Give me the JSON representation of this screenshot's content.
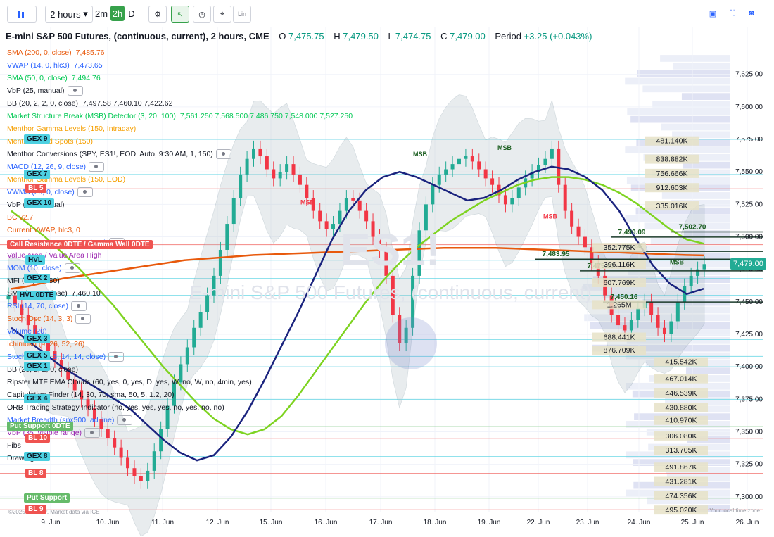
{
  "toolbar": {
    "interval_label": "2 hours",
    "quick_intervals": [
      "2m",
      "2h",
      "D"
    ],
    "active_interval": "2h",
    "lin_label": "Lin"
  },
  "header": {
    "symbol": "E-mini S&P 500 Futures, (continuous, current), 2 hours, CME",
    "open_label": "O",
    "open": "7,475.75",
    "high_label": "H",
    "high": "7,479.50",
    "low_label": "L",
    "low": "7,474.75",
    "close_label": "C",
    "close": "7,479.00",
    "period_label": "Period",
    "period": "+3.25 (+0.043%)"
  },
  "indicators": [
    {
      "text": "SMA (200, 0, close)",
      "value": "7,485.76",
      "color": "#e8590c"
    },
    {
      "text": "VWAP (14, 0, hlc3)",
      "value": "7,473.65",
      "color": "#2962ff"
    },
    {
      "text": "SMA (50, 0, close)",
      "value": "7,494.76",
      "color": "#00c853"
    },
    {
      "text": "VbP (25, manual)",
      "value": "",
      "color": "#131722"
    },
    {
      "text": "BB (20, 2, 2, 0, close)",
      "value": "7,497.58  7,460.10  7,422.62",
      "color": "#131722"
    },
    {
      "text": "Market Structure Break (MSB) Detector (3, 20, 100)",
      "value": "7,561.250  7,568.500  7,486.750  7,548.000  7,527.250",
      "color": "#00c853"
    },
    {
      "text": "Menthor Gamma Levels (150, Intraday)",
      "value": "",
      "color": "#f59f00"
    },
    {
      "text": "Menthor Blind Spots (150)",
      "value": "",
      "color": "#f59f00"
    },
    {
      "text": "Menthor Conversions (SPY, ES1!, EOD, Auto, 9:30 AM, 1, 150)",
      "value": "",
      "color": "#131722"
    },
    {
      "text": "MACD (12, 26, 9, close)",
      "value": "",
      "color": "#2962ff"
    },
    {
      "text": "Menthor Gamma Levels (150, EOD)",
      "value": "",
      "color": "#f59f00"
    },
    {
      "text": "VWMA (20, 0, close)",
      "value": "",
      "color": "#2962ff"
    },
    {
      "text": "VbP (35, manual)",
      "value": "",
      "color": "#131722"
    },
    {
      "text": "BC v2.7",
      "value": "",
      "color": "#e8590c"
    },
    {
      "text": "Current VWAP, hlc3, 0",
      "value": "",
      "color": "#e8590c"
    },
    {
      "text": "URSI (14, 20, 2, 80, 20, close)",
      "value": "",
      "color": "#2962ff"
    },
    {
      "text": "Value Area / Value Area High",
      "value": "",
      "color": "#9c27b0"
    },
    {
      "text": "MOM (10, close)",
      "value": "",
      "color": "#2962ff"
    },
    {
      "text": "MFI (14, 20, 80)",
      "value": "",
      "color": "#131722"
    },
    {
      "text": "SMA (20, 0, close)",
      "value": "7,460.10",
      "color": "#131722"
    },
    {
      "text": "RSI (14, 70, close)",
      "value": "",
      "color": "#2962ff"
    },
    {
      "text": "Stoch Osc (14, 3, 3)",
      "value": "",
      "color": "#e8590c"
    },
    {
      "text": "Volume (20)",
      "value": "",
      "color": "#2962ff"
    },
    {
      "text": "Ichimoku (9, 26, 52, 26)",
      "value": "",
      "color": "#e8590c"
    },
    {
      "text": "Stoch RSI (3, 3, 14, 14, close)",
      "value": "",
      "color": "#2962ff"
    },
    {
      "text": "BB (20, 2, 2, 0, close)",
      "value": "",
      "color": "#131722"
    },
    {
      "text": "Ripster MTF EMA Clouds (60, yes, 0, yes, D, yes, W, no, W, no, 4min, yes)",
      "value": "",
      "color": "#131722"
    },
    {
      "text": "Capitulation Finder (14, 30, 70, sma, 50, 5, 1.2, 20)",
      "value": "",
      "color": "#131722"
    },
    {
      "text": "ORB Trading Strategy Indicator (no, yes, yes, yes, no, yes, no, no)",
      "value": "",
      "color": "#131722"
    },
    {
      "text": "Market Breadth (spx500, ad line)",
      "value": "",
      "color": "#2962ff"
    },
    {
      "text": "VbP (35, visible range)",
      "value": "",
      "color": "#9c27b0"
    },
    {
      "text": "Fibs",
      "value": "",
      "color": "#131722"
    },
    {
      "text": "Drawings",
      "value": "",
      "color": "#131722"
    }
  ],
  "chart_data": {
    "type": "candlestick",
    "title": "E-mini S&P 500 Futures, (continuous, current), 2 hours, CME",
    "ylim": [
      7288,
      7640
    ],
    "y_ticks": [
      "7,625.00",
      "7,600.00",
      "7,575.00",
      "7,550.00",
      "7,525.00",
      "7,500.00",
      "7,475.00",
      "7,450.00",
      "7,425.00",
      "7,400.00",
      "7,375.00",
      "7,350.00",
      "7,325.00",
      "7,300.00"
    ],
    "x_ticks": [
      "9. Jun",
      "10. Jun",
      "11. Jun",
      "12. Jun",
      "15. Jun",
      "16. Jun",
      "17. Jun",
      "18. Jun",
      "19. Jun",
      "22. Jun",
      "23. Jun",
      "24. Jun",
      "25. Jun",
      "26. Jun"
    ],
    "last_price": "7,479.00",
    "watermark_symbol": "ES1!",
    "watermark_name": "E-mini S&P 500 Futures, (continuous, current)",
    "series_price": [
      7455,
      7448,
      7440,
      7432,
      7425,
      7418,
      7412,
      7405,
      7398,
      7390,
      7382,
      7375,
      7368,
      7360,
      7352,
      7345,
      7338,
      7330,
      7322,
      7316,
      7312,
      7320,
      7335,
      7352,
      7370,
      7388,
      7402,
      7415,
      7430,
      7442,
      7455,
      7470,
      7490,
      7510,
      7530,
      7548,
      7560,
      7568,
      7562,
      7552,
      7545,
      7550,
      7556,
      7548,
      7540,
      7530,
      7520,
      7512,
      7506,
      7510,
      7520,
      7530,
      7528,
      7520,
      7512,
      7500,
      7490,
      7470,
      7440,
      7418,
      7430,
      7470,
      7505,
      7525,
      7540,
      7548,
      7552,
      7556,
      7560,
      7562,
      7558,
      7552,
      7545,
      7540,
      7532,
      7525,
      7530,
      7538,
      7545,
      7550,
      7555,
      7560,
      7568,
      7540,
      7520,
      7508,
      7500,
      7492,
      7480,
      7470,
      7455,
      7440,
      7432,
      7428,
      7436,
      7445,
      7450,
      7440,
      7430,
      7425,
      7435,
      7450,
      7462,
      7470,
      7475,
      7479
    ],
    "series_sma200": [
      7460,
      7462,
      7465,
      7468,
      7470,
      7472,
      7474,
      7476,
      7478,
      7480,
      7482,
      7483,
      7484,
      7485,
      7486,
      7486.5,
      7487,
      7487.5,
      7488,
      7488.5,
      7489,
      7489.5,
      7490,
      7490.5,
      7491,
      7491.5,
      7491.5,
      7491.5,
      7491.5,
      7491,
      7490.5,
      7490,
      7489.5,
      7489,
      7488.5,
      7488,
      7487.5,
      7487,
      7486.5,
      7486,
      7485.76
    ],
    "series_sma50": [
      7520,
      7510,
      7500,
      7488,
      7476,
      7462,
      7448,
      7432,
      7416,
      7400,
      7386,
      7372,
      7360,
      7352,
      7348,
      7352,
      7362,
      7378,
      7396,
      7414,
      7432,
      7450,
      7466,
      7480,
      7492,
      7502,
      7512,
      7520,
      7528,
      7534,
      7540,
      7544,
      7546,
      7546,
      7544,
      7540,
      7534,
      7526,
      7516,
      7506,
      7498,
      7494.76
    ],
    "series_sma20": [
      7430,
      7420,
      7410,
      7400,
      7392,
      7384,
      7376,
      7368,
      7356,
      7344,
      7334,
      7328,
      7332,
      7346,
      7366,
      7390,
      7416,
      7442,
      7470,
      7498,
      7520,
      7536,
      7546,
      7550,
      7546,
      7540,
      7534,
      7528,
      7530,
      7536,
      7544,
      7550,
      7554,
      7552,
      7546,
      7536,
      7520,
      7498,
      7478,
      7464,
      7456,
      7460.1
    ],
    "levels": [
      {
        "label": "GEX 9",
        "value": 7575,
        "color": "#4dd0e1"
      },
      {
        "label": "GEX 7",
        "value": 7548,
        "color": "#4dd0e1"
      },
      {
        "label": "BL 5",
        "value": 7537,
        "color": "#ef5350"
      },
      {
        "label": "GEX 10",
        "value": 7526,
        "color": "#4dd0e1"
      },
      {
        "label": "Call Resistance 0DTE / Gamma Wall 0DTE",
        "value": 7494,
        "color": "#ef5350"
      },
      {
        "label": "HVL",
        "value": 7482,
        "color": "#4dd0e1"
      },
      {
        "label": "GEX 2",
        "value": 7468,
        "color": "#4dd0e1"
      },
      {
        "label": "HVL 0DTE",
        "value": 7455,
        "color": "#4dd0e1"
      },
      {
        "label": "GEX 3",
        "value": 7421,
        "color": "#4dd0e1"
      },
      {
        "label": "GEX 5",
        "value": 7408,
        "color": "#4dd0e1"
      },
      {
        "label": "GEX 1",
        "value": 7400,
        "color": "#4dd0e1"
      },
      {
        "label": "GEX 4",
        "value": 7375,
        "color": "#4dd0e1"
      },
      {
        "label": "Put Support 0DTE",
        "value": 7354,
        "color": "#66bb6a"
      },
      {
        "label": "BL 10",
        "value": 7345,
        "color": "#ef5350"
      },
      {
        "label": "GEX 8",
        "value": 7331,
        "color": "#4dd0e1"
      },
      {
        "label": "BL 8",
        "value": 7318,
        "color": "#ef5350"
      },
      {
        "label": "Put Support",
        "value": 7299,
        "color": "#66bb6a"
      },
      {
        "label": "BL 9",
        "value": 7290,
        "color": "#ef5350"
      }
    ],
    "volume_labels": [
      {
        "text": "481.140K",
        "y": 7573
      },
      {
        "text": "838.882K",
        "y": 7559
      },
      {
        "text": "756.666K",
        "y": 7548
      },
      {
        "text": "912.603K",
        "y": 7537
      },
      {
        "text": "335.016K",
        "y": 7523
      },
      {
        "text": "352.775K",
        "y": 7491
      },
      {
        "text": "396.116K",
        "y": 7478
      },
      {
        "text": "607.769K",
        "y": 7464
      },
      {
        "text": "1.265M",
        "y": 7447
      },
      {
        "text": "688.441K",
        "y": 7422
      },
      {
        "text": "876.709K",
        "y": 7412
      },
      {
        "text": "415.542K",
        "y": 7403
      },
      {
        "text": "467.014K",
        "y": 7390
      },
      {
        "text": "446.539K",
        "y": 7379
      },
      {
        "text": "430.880K",
        "y": 7368
      },
      {
        "text": "410.970K",
        "y": 7358
      },
      {
        "text": "306.080K",
        "y": 7346
      },
      {
        "text": "313.705K",
        "y": 7335
      },
      {
        "text": "491.867K",
        "y": 7322
      },
      {
        "text": "431.281K",
        "y": 7311
      },
      {
        "text": "474.356K",
        "y": 7300
      },
      {
        "text": "495.020K",
        "y": 7289
      }
    ],
    "msb_labels": [
      "MSB",
      "MSB",
      "MSB",
      "MSB",
      "MSB"
    ],
    "msb_level_labels": [
      "7,502.70",
      "7,499.09",
      "7,489.66",
      "7,483.95",
      "7,475.07",
      "7,450.16"
    ],
    "credit": "©2025 Menthor, Market data via ICE",
    "tz_note": "Your local time zone"
  },
  "colors": {
    "up": "#22ab94",
    "down": "#f23645",
    "sma200": "#e8590c",
    "sma50": "#7ed321",
    "sma20": "#1a237e"
  }
}
